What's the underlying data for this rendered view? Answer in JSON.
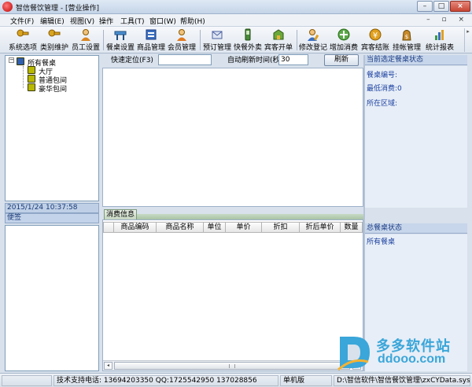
{
  "window": {
    "title": "智信餐饮管理 - [营业操作]",
    "min_label": "–",
    "max_label": "□",
    "close_label": "×"
  },
  "menu": {
    "items": [
      "文件(F)",
      "编辑(E)",
      "视图(V)",
      "操作",
      "工具(T)",
      "窗口(W)",
      "帮助(H)"
    ],
    "mdi_controls": "– ▫ ×"
  },
  "toolbar": {
    "buttons": [
      {
        "label": "系统选项",
        "icon": "key-icon",
        "color": "#d9a521"
      },
      {
        "label": "类别维护",
        "icon": "key-icon",
        "color": "#d9a521"
      },
      {
        "label": "员工设置",
        "icon": "user-icon",
        "color": "#d98521"
      },
      {
        "label": "餐桌设置",
        "icon": "table-icon",
        "color": "#4a8fd0"
      },
      {
        "label": "商品管理",
        "icon": "goods-icon",
        "color": "#3a6fc0"
      },
      {
        "label": "会员管理",
        "icon": "member-icon",
        "color": "#e07a20"
      },
      {
        "label": "预订管理",
        "icon": "booking-icon",
        "color": "#4a5fa0"
      },
      {
        "label": "快餐外卖",
        "icon": "phone-icon",
        "color": "#4a8a3a"
      },
      {
        "label": "宾客开单",
        "icon": "open-bill-icon",
        "color": "#6aa83a"
      },
      {
        "label": "修改登记",
        "icon": "edit-user-icon",
        "color": "#3a70c0"
      },
      {
        "label": "增加消费",
        "icon": "add-consume-icon",
        "color": "#5aa848"
      },
      {
        "label": "宾客结账",
        "icon": "checkout-icon",
        "color": "#e0a020"
      },
      {
        "label": "挂帐管理",
        "icon": "credit-icon",
        "color": "#c88a2a"
      },
      {
        "label": "统计报表",
        "icon": "chart-icon",
        "color": "#3a9a4a"
      }
    ],
    "scroll_label": "▸"
  },
  "tree": {
    "expander": "−",
    "root": "所有餐桌",
    "children": [
      "大厅",
      "普通包间",
      "豪华包间"
    ]
  },
  "datetime": "2015/1/24 10:37:58",
  "memo_label": "便签",
  "quick_locate": {
    "label": "快速定位(F3)",
    "value": "",
    "refresh_label": "自动刷新时间(秒)",
    "refresh_value": "30",
    "refresh_button": "刷新"
  },
  "current_table": {
    "header": "当前选定餐桌状态",
    "lines": [
      "餐桌编号:",
      "最低消费:0",
      "所在区域:"
    ]
  },
  "consume": {
    "tab": "消费信息",
    "columns": [
      "",
      "商品编码",
      "商品名称",
      "单位",
      "单价",
      "折扣",
      "折后单价",
      "数量"
    ]
  },
  "total_table": {
    "header": "总餐桌状态",
    "line": "所有餐桌"
  },
  "scrollbar": {
    "left": "◂",
    "right": "▸"
  },
  "statusbar": {
    "cells": [
      "",
      "技术支持电话: 13694203350 QQ:1725542950 137028856",
      "单机版",
      "D:\\智信软件\\智信餐饮管理\\zxCYData.sys  当前"
    ]
  },
  "watermark": {
    "cn": "多多软件站",
    "en": "ddooo.com"
  },
  "colors": {
    "accent": "#1a3fa0",
    "panel_header": "#c7d6ea",
    "watermark": "#3aa6d9"
  }
}
